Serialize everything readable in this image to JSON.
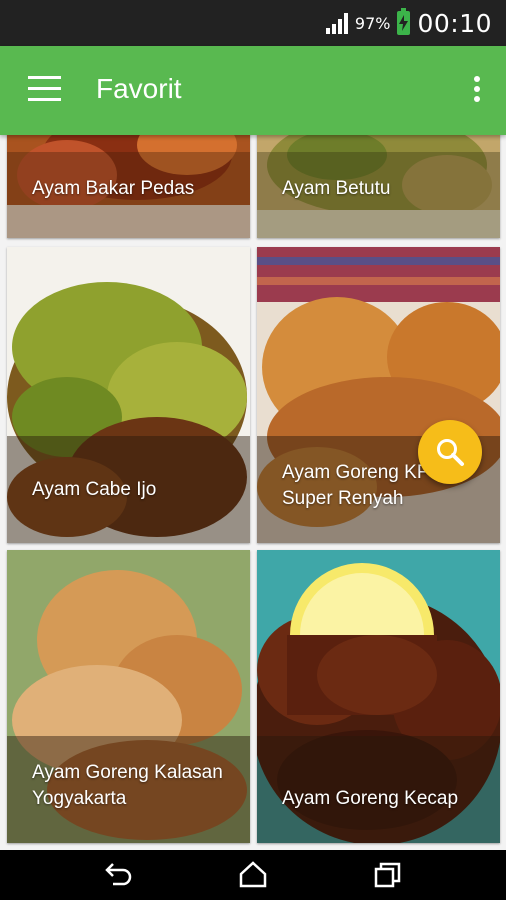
{
  "status_bar": {
    "battery_percent": "97%",
    "time": "00:10",
    "icons": [
      "signal-icon",
      "battery-charging-icon"
    ]
  },
  "app_bar": {
    "title": "Favorit",
    "icons": [
      "menu-icon",
      "overflow-menu-icon"
    ],
    "color": "#59b950"
  },
  "recipes": [
    {
      "name": "Ayam Bakar Pedas"
    },
    {
      "name": "Ayam Betutu"
    },
    {
      "name": "Ayam Cabe Ijo"
    },
    {
      "name": "Ayam Goreng KFC Super Renyah"
    },
    {
      "name": "Ayam Goreng Kalasan Yogyakarta"
    },
    {
      "name": "Ayam Goreng Kecap"
    }
  ],
  "fab": {
    "icon": "search-icon",
    "color": "#f6bd19"
  },
  "nav_bar": {
    "icons": [
      "back-icon",
      "home-icon",
      "recent-apps-icon"
    ]
  }
}
